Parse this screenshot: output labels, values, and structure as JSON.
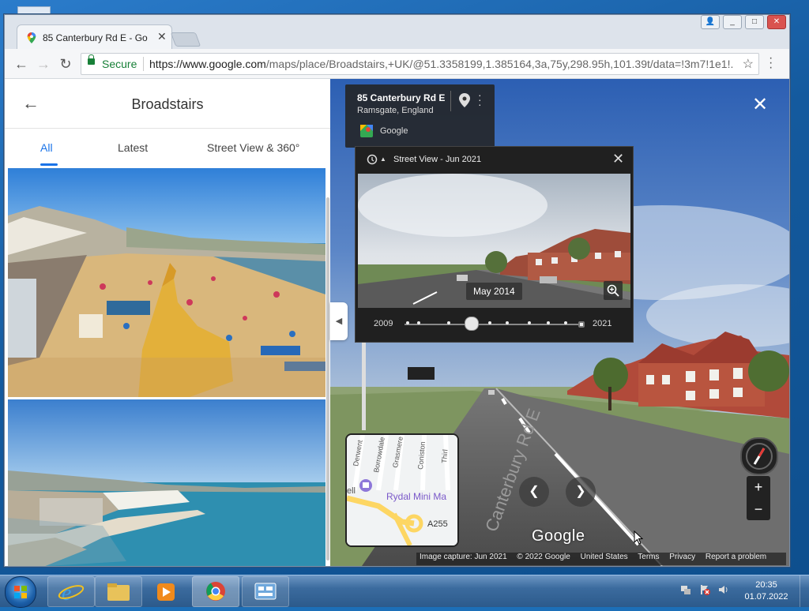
{
  "browser": {
    "tab_title": "85 Canterbury Rd E - Go",
    "secure_label": "Secure",
    "url_host": "https://www.google.com",
    "url_path": "/maps/place/Broadstairs,+UK/@51.3358199,1.385164,3a,75y,298.95h,101.39t/data=!3m7!1e1!..."
  },
  "photos_panel": {
    "title": "Broadstairs",
    "tabs": [
      {
        "label": "All",
        "active": true
      },
      {
        "label": "Latest",
        "active": false
      },
      {
        "label": "Street View & 360°",
        "active": false
      }
    ]
  },
  "street_view": {
    "address": "85 Canterbury Rd E",
    "locality": "Ramsgate, England",
    "attribution": "Google",
    "watermark": "Google",
    "road_label": "Canterbury Rd E",
    "minimap": {
      "poi": "Rydal Mini Ma",
      "road": "A255",
      "streets": [
        "Derwent",
        "Borrowdale",
        "Grasmere",
        "Coniston",
        "Thirl"
      ],
      "edge": "ell"
    },
    "footer": {
      "capture": "Image capture: Jun 2021",
      "copyright": "© 2022 Google",
      "country": "United States",
      "terms": "Terms",
      "privacy": "Privacy",
      "report": "Report a problem"
    }
  },
  "time_machine": {
    "title": "Street View - Jun 2021",
    "selected_date": "May 2014",
    "start_year": "2009",
    "end_year": "2021",
    "selected_position": 0.37
  },
  "taskbar": {
    "time": "20:35",
    "date": "01.07.2022"
  },
  "colors": {
    "accent": "#1a73e8",
    "secure": "#188038"
  }
}
